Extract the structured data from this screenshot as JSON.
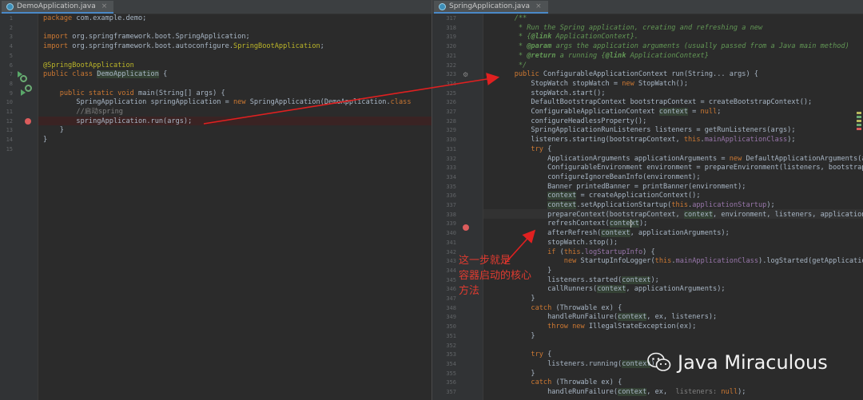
{
  "left_tab": {
    "label": "DemoApplication.java"
  },
  "right_tab": {
    "label": "SpringApplication.java"
  },
  "tab_close_glyph": "×",
  "left_line_numbers": [
    "1",
    "2",
    "3",
    "4",
    "5",
    "6",
    "7",
    "8",
    "9",
    "10",
    "11",
    "12",
    "13",
    "14",
    "15"
  ],
  "left_code": [
    "<span class='kw'>package</span> com.example.demo;",
    "",
    "<span class='kw'>import</span> org.springframework.boot.SpringApplication;",
    "<span class='kw'>import</span> org.springframework.boot.autoconfigure.<span class='an'>SpringBootApplication</span>;",
    "",
    "<span class='an'>@SpringBootApplication</span>",
    "<span class='kw'>public class</span> <span class='hl'>DemoApplication</span> {",
    "",
    "    <span class='kw'>public static void</span> main(String[] args) {",
    "        SpringApplication springApplication = <span class='kw'>new</span> SpringApplication(DemoApplication.<span class='kw'>class</span>",
    "        <span class='cm'>//启动spring</span>",
    "        springApplication.run(args);",
    "    }",
    "}",
    ""
  ],
  "right_line_numbers": [
    "317",
    "318",
    "319",
    "320",
    "321",
    "322",
    "323",
    "324",
    "325",
    "326",
    "327",
    "328",
    "329",
    "330",
    "331",
    "332",
    "333",
    "334",
    "335",
    "336",
    "337",
    "338",
    "339",
    "340",
    "341",
    "342",
    "343",
    "344",
    "345",
    "346",
    "347",
    "348",
    "349",
    "350",
    "351",
    "352",
    "353",
    "354",
    "355",
    "356",
    "357"
  ],
  "right_code": [
    "    <span class='dc'>/**</span>",
    "<span class='dc'>     * Run the Spring application, creating and refreshing a new</span>",
    "<span class='dc'>     * {</span><span class='dt'>@link</span><span class='dc'> ApplicationContext}.</span>",
    "<span class='dc'>     * </span><span class='dt'>@param</span><span class='dc'> args the application arguments (usually passed from a Java main method)</span>",
    "<span class='dc'>     * </span><span class='dt'>@return</span><span class='dc'> a running {</span><span class='dt'>@link</span><span class='dc'> ApplicationContext}</span>",
    "<span class='dc'>     */</span>",
    "    <span class='kw'>public</span> ConfigurableApplicationContext run(String... args) {",
    "        StopWatch stopWatch = <span class='kw'>new</span> StopWatch();",
    "        stopWatch.start();",
    "        DefaultBootstrapContext bootstrapContext = createBootstrapContext();",
    "        ConfigurableApplicationContext <span class='hl'>context</span> = <span class='kw'>null</span>;",
    "        configureHeadlessProperty();",
    "        SpringApplicationRunListeners listeners = getRunListeners(args);",
    "        listeners.starting(bootstrapContext, <span class='kw'>this</span>.<span class='fd'>mainApplicationClass</span>);",
    "        <span class='kw'>try</span> {",
    "            ApplicationArguments applicationArguments = <span class='kw'>new</span> DefaultApplicationArguments(args);",
    "            ConfigurableEnvironment environment = prepareEnvironment(listeners, bootstrapContext, applicationArguments);",
    "            configureIgnoreBeanInfo(environment);",
    "            Banner printedBanner = printBanner(environment);",
    "            <span class='hl'>context</span> = createApplicationContext();",
    "            <span class='hl'>context</span>.setApplicationStartup(<span class='kw'>this</span>.<span class='fd'>applicationStartup</span>);",
    "            prepareContext(bootstrapContext, <span class='hl'>context</span>, environment, listeners, applicationArguments, printedBanner);",
    "            refreshContext(<span class='hl'>cont<span class='caret'>e</span>xt</span>);",
    "            afterRefresh(<span class='hl'>context</span>, applicationArguments);",
    "            stopWatch.stop();",
    "            <span class='kw'>if</span> (<span class='kw'>this</span>.<span class='fd'>logStartupInfo</span>) {",
    "                <span class='kw'>new</span> StartupInfoLogger(<span class='kw'>this</span>.<span class='fd'>mainApplicationClass</span>).logStarted(getApplicationLog(), stopWatch);",
    "            }",
    "            listeners.started(<span class='hl'>context</span>);",
    "            callRunners(<span class='hl'>context</span>, applicationArguments);",
    "        }",
    "        <span class='kw'>catch</span> (Throwable ex) {",
    "            handleRunFailure(<span class='hl'>context</span>, ex, listeners);",
    "            <span class='kw'>throw new</span> IllegalStateException(ex);",
    "        }",
    "",
    "        <span class='kw'>try</span> {",
    "            listeners.running(<span class='hl'>context</span>);",
    "        }",
    "        <span class='kw'>catch</span> (Throwable ex) {",
    "            handleRunFailure(<span class='hl'>context</span>, ex,  <span class='cm'>listeners:</span> <span class='kw'>null</span>);"
  ],
  "annotation_text": "这一步就是\n容器启动的核心\n方法",
  "watermark_text": "Java Miraculous",
  "colors": {
    "annotation": "#e03b30",
    "keyword": "#cc7832",
    "annotation_code": "#bbb529",
    "doc": "#629755"
  }
}
